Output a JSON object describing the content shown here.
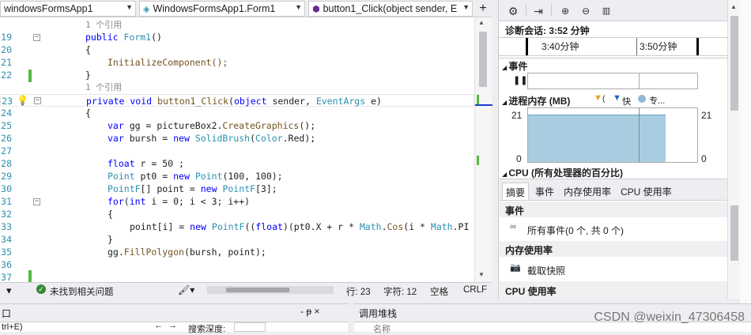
{
  "nav": {
    "project": "windowsFormsApp1",
    "class": "WindowsFormsApp1.Form1",
    "member": "button1_Click(object sender, E",
    "add": "+"
  },
  "code": {
    "ref1": "1 个引用",
    "l19": "public Form1()",
    "l20": "{",
    "l21": "InitializeComponent();",
    "l22": "}",
    "ref2": "1 个引用",
    "l23": "private void button1_Click(object sender, EventArgs e)",
    "l24": "{",
    "l25": "var gg = pictureBox2.CreateGraphics();",
    "l26": "var bursh = new SolidBrush(Color.Red);",
    "l28": "float r = 50 ;",
    "l29": "Point pt0 = new Point(100, 100);",
    "l30": "PointF[] point = new PointF[3];",
    "l31": "for(int i = 0; i < 3; i++)",
    "l32": "{",
    "l33": "point[i] = new PointF((float)(pt0.X + r * Math.Cos(i * Math.PI",
    "l34": "}",
    "l35": "gg.FillPolygon(bursh, point);",
    "numbers": [
      "19",
      "20",
      "21",
      "22",
      "23",
      "24",
      "25",
      "26",
      "27",
      "28",
      "29",
      "30",
      "31",
      "32",
      "33",
      "34",
      "35",
      "36",
      "37"
    ]
  },
  "status": {
    "issues": "未找到相关问题",
    "line": "行: 23",
    "char": "字符: 12",
    "space": "空格",
    "eol": "CRLF"
  },
  "bottom": {
    "left_title": "口",
    "left_pin": "- ᵽ ×",
    "left_sub": "trl+E)",
    "left_search": "搜索深度:",
    "right_title": "调用堆栈",
    "right_col": "名称"
  },
  "diag": {
    "session": "诊断会话: 3:52 分钟",
    "t1": "3:40分钟",
    "t2": "3:50分钟",
    "events": "事件",
    "memory": "进程内存 (MB)",
    "legend1": "(",
    "legend2": "快",
    "legend3": "专...",
    "mem_max_left": "21",
    "mem_min_left": "0",
    "mem_max_right": "21",
    "mem_min_right": "0",
    "cpu": "CPU (所有处理器的百分比)",
    "tabs": [
      "摘要",
      "事件",
      "内存使用率",
      "CPU 使用率"
    ],
    "sec_events": "事件",
    "all_events": "所有事件(0 个, 共 0 个)",
    "sec_memory": "内存使用率",
    "snapshot": "截取快照",
    "sec_cpu": "CPU 使用率",
    "memory_level": 0.88
  },
  "watermark": "CSDN @weixin_47306458"
}
